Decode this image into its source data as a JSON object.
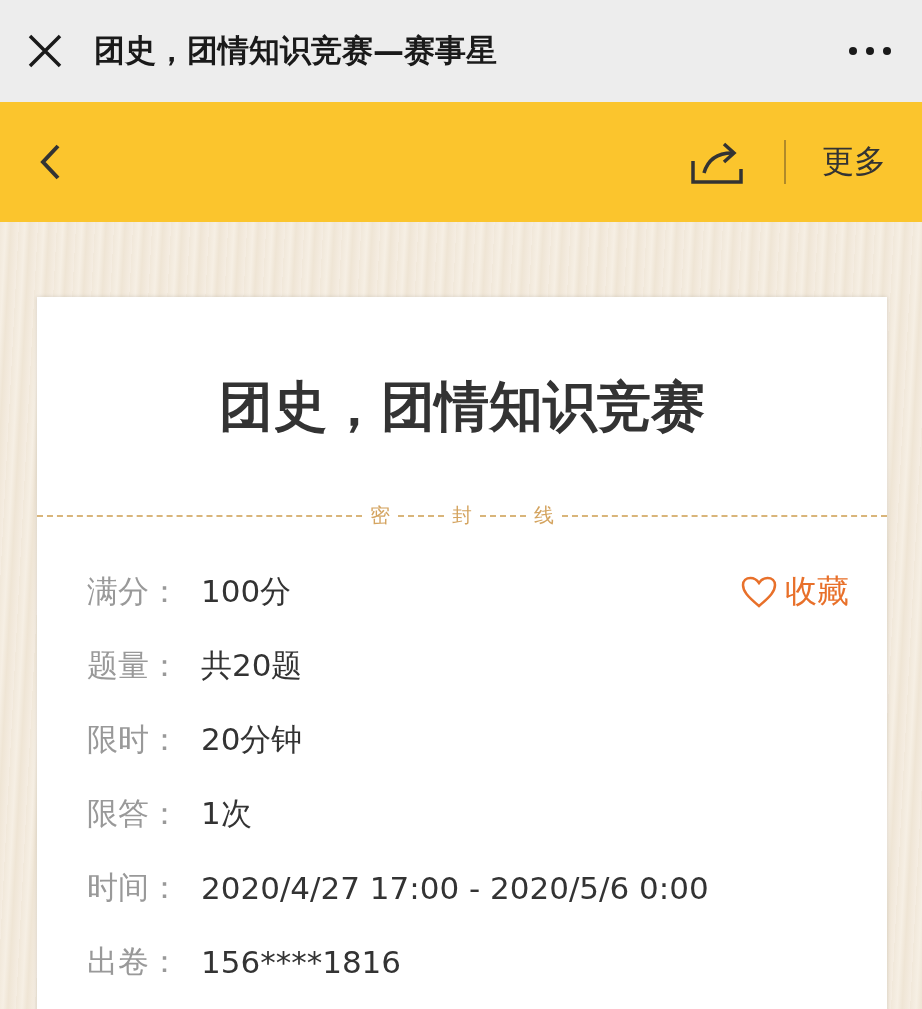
{
  "window": {
    "title": "团史，团情知识竞赛—赛事星"
  },
  "nav": {
    "more": "更多"
  },
  "card": {
    "title": "团史，团情知识竞赛",
    "seal_line": [
      "密",
      "封",
      "线"
    ],
    "favorite": {
      "label": "收藏",
      "favorited": false
    },
    "rows": [
      {
        "label": "满分：",
        "value": "100分"
      },
      {
        "label": "题量：",
        "value": "共20题"
      },
      {
        "label": "限时：",
        "value": "20分钟"
      },
      {
        "label": "限答：",
        "value": "1次"
      },
      {
        "label": "时间：",
        "value": "2020/4/27 17:00 - 2020/5/6 0:00"
      },
      {
        "label": "出卷：",
        "value": "156****1816"
      }
    ]
  }
}
